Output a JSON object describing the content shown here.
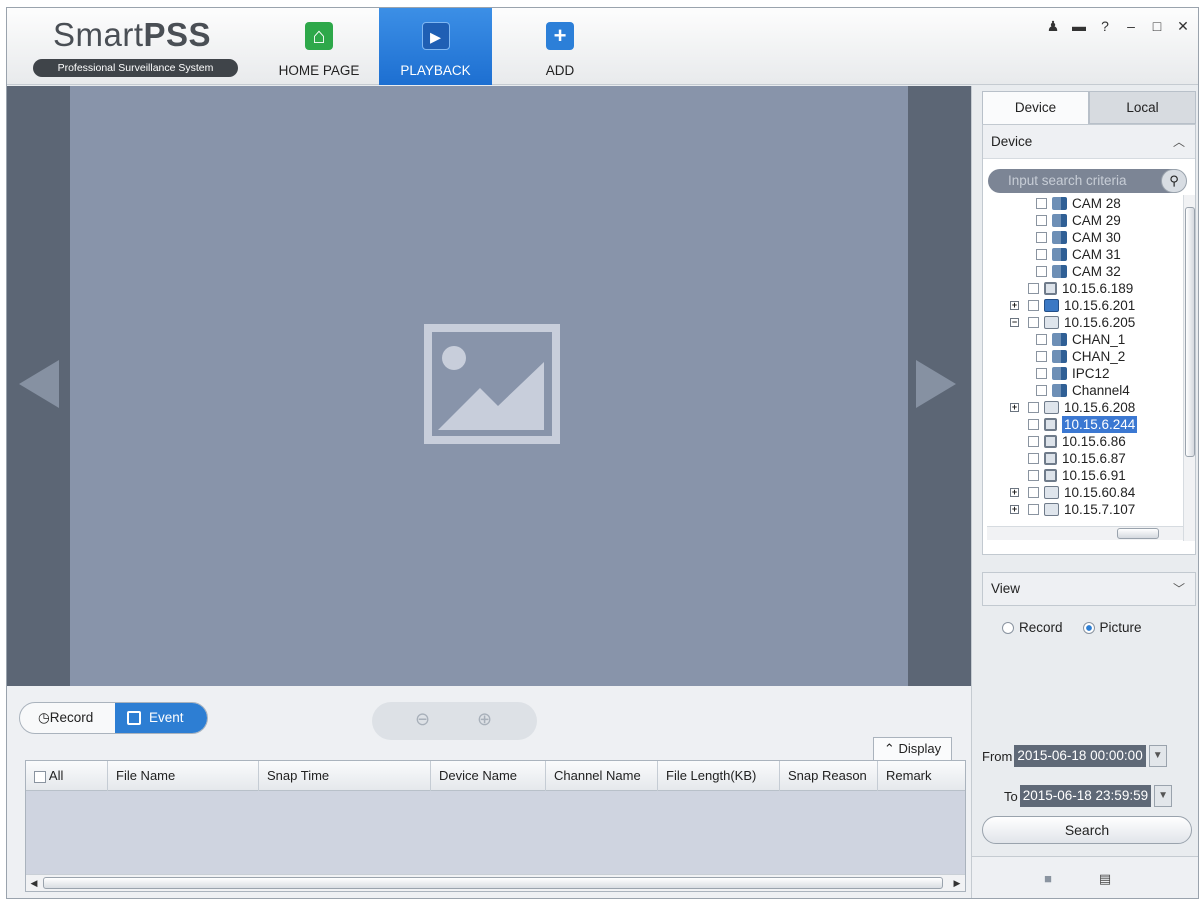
{
  "app": {
    "logo_main": "Smart",
    "logo_bold": "PSS",
    "logo_sub": "Professional Surveillance System"
  },
  "nav": {
    "home": "HOME PAGE",
    "playback": "PLAYBACK",
    "add": "ADD"
  },
  "window_controls": [
    "user-icon",
    "lock-icon",
    "help-icon",
    "minimize-icon",
    "maximize-icon",
    "close-icon"
  ],
  "bottom": {
    "mode_record": "Record",
    "mode_event": "Event",
    "display_label": "Display",
    "columns": [
      "All",
      "File Name",
      "Snap Time",
      "Device Name",
      "Channel Name",
      "File Length(KB)",
      "Snap Reason",
      "Remark"
    ]
  },
  "right": {
    "tabs": {
      "device": "Device",
      "local": "Local"
    },
    "device_section": "Device",
    "search_placeholder": "Input search criteria",
    "tree": [
      {
        "label": "CAM 28",
        "type": "cam",
        "level": 2,
        "selected": false
      },
      {
        "label": "CAM 29",
        "type": "cam",
        "level": 2,
        "selected": false
      },
      {
        "label": "CAM 30",
        "type": "cam",
        "level": 2,
        "selected": false
      },
      {
        "label": "CAM 31",
        "type": "cam",
        "level": 2,
        "selected": false
      },
      {
        "label": "CAM 32",
        "type": "cam",
        "level": 2,
        "selected": false
      },
      {
        "label": "10.15.6.189",
        "type": "ipc",
        "level": 1,
        "selected": false,
        "expander": ""
      },
      {
        "label": "10.15.6.201",
        "type": "pc",
        "level": 1,
        "selected": false,
        "expander": "+"
      },
      {
        "label": "10.15.6.205",
        "type": "dvr",
        "level": 1,
        "selected": false,
        "expander": "−"
      },
      {
        "label": "CHAN_1",
        "type": "cam",
        "level": 2,
        "selected": false
      },
      {
        "label": "CHAN_2",
        "type": "cam",
        "level": 2,
        "selected": false
      },
      {
        "label": "IPC12",
        "type": "cam",
        "level": 2,
        "selected": false
      },
      {
        "label": "Channel4",
        "type": "cam",
        "level": 2,
        "selected": false
      },
      {
        "label": "10.15.6.208",
        "type": "dvr",
        "level": 1,
        "selected": false,
        "expander": "+"
      },
      {
        "label": "10.15.6.244",
        "type": "ipc",
        "level": 1,
        "selected": true,
        "expander": ""
      },
      {
        "label": "10.15.6.86",
        "type": "ipc",
        "level": 1,
        "selected": false,
        "expander": ""
      },
      {
        "label": "10.15.6.87",
        "type": "ipc",
        "level": 1,
        "selected": false,
        "expander": ""
      },
      {
        "label": "10.15.6.91",
        "type": "ipc",
        "level": 1,
        "selected": false,
        "expander": ""
      },
      {
        "label": "10.15.60.84",
        "type": "dvr",
        "level": 1,
        "selected": false,
        "expander": "+"
      },
      {
        "label": "10.15.7.107",
        "type": "dvr",
        "level": 1,
        "selected": false,
        "expander": "+"
      }
    ],
    "view_section": "View",
    "radio_record": "Record",
    "radio_picture": "Picture",
    "from_label": "From",
    "from_value": "2015-06-18 00:00:00",
    "to_label": "To",
    "to_value": "2015-06-18 23:59:59",
    "search_button": "Search"
  }
}
